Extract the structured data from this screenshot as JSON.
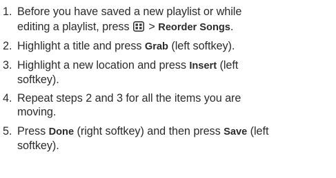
{
  "steps": [
    {
      "num": "1.",
      "a": "Before you have saved a new playlist or while",
      "b": "editing a playlist, press ",
      "icon": "menu-key-icon",
      "c": " > ",
      "kw": "Reorder Songs",
      "d": "."
    },
    {
      "num": "2.",
      "a": "Highlight a title and press ",
      "kw": "Grab",
      "b": " (left softkey)."
    },
    {
      "num": "3.",
      "a": "Highlight a new location and press ",
      "kw": "Insert",
      "b": " (left",
      "c": "softkey)."
    },
    {
      "num": "4.",
      "a": "Repeat steps 2 and 3 for all the items you are",
      "b": "moving."
    },
    {
      "num": "5.",
      "a": "Press ",
      "kw1": "Done",
      "b": " (right softkey) and then press ",
      "kw2": "Save",
      "c": " (left",
      "d": "softkey)."
    }
  ]
}
